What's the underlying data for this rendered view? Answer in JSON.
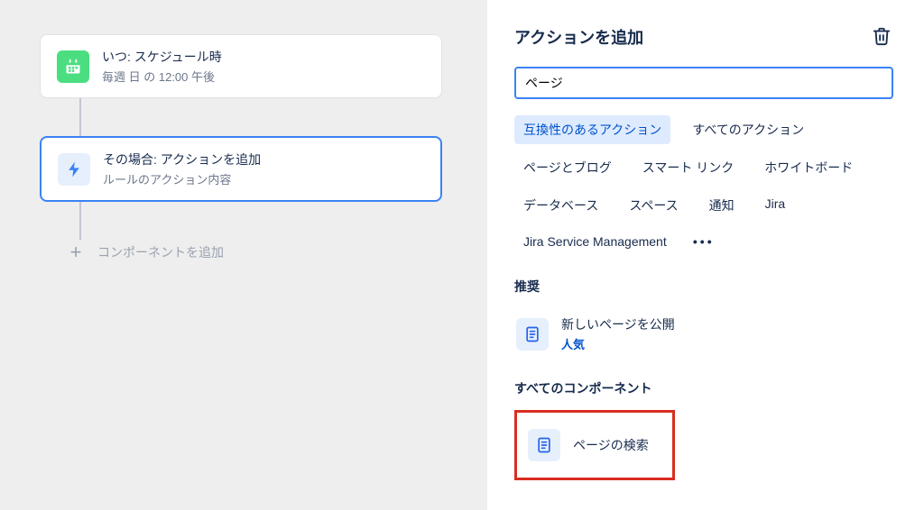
{
  "left": {
    "step_when": {
      "title": "いつ: スケジュール時",
      "subtitle": "毎週 日 の 12:00 午後"
    },
    "step_then": {
      "title": "その場合: アクションを追加",
      "subtitle": "ルールのアクション内容"
    },
    "add_component_label": "コンポーネントを追加"
  },
  "right": {
    "title": "アクションを追加",
    "search_value": "ページ",
    "chips": {
      "compatible": "互換性のあるアクション",
      "all_actions": "すべてのアクション",
      "pages_blogs": "ページとブログ",
      "smart_links": "スマート リンク",
      "whiteboard": "ホワイトボード",
      "database": "データベース",
      "space": "スペース",
      "notification": "通知",
      "jira": "Jira",
      "jsm": "Jira Service Management"
    },
    "recommended_label": "推奨",
    "recommended_item": {
      "title": "新しいページを公開",
      "badge": "人気"
    },
    "all_components_label": "すべてのコンポーネント",
    "all_item": {
      "title": "ページの検索"
    }
  }
}
